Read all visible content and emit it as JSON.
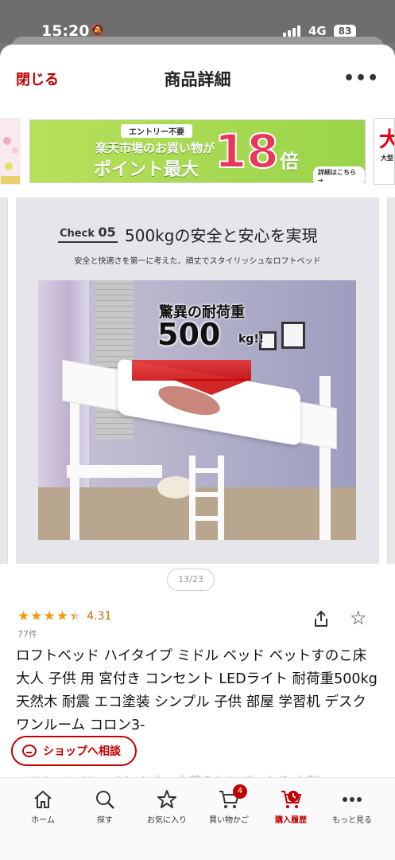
{
  "status_bar": {
    "time": "15:20",
    "network": "4G",
    "battery": "83"
  },
  "nav": {
    "close_label": "閉じる",
    "title": "商品詳細",
    "more_label": "•••"
  },
  "banner": {
    "entry": "エントリー不要",
    "line1": "楽天市場のお買い物が",
    "line2": "ポイント最大",
    "big_number": "18",
    "suffix": "倍",
    "detail": "詳細はこちら ➔",
    "next_banner_peek": "大",
    "next_banner_sub": "大型"
  },
  "gallery": {
    "check_label": "Check",
    "check_number": "05",
    "headline": "500kgの安全と安心を実現",
    "subline": "安全と快適さを第一に考えた、頑丈でスタイリッシュなロフトベッド",
    "overlay_title": "驚異の耐荷重",
    "overlay_value": "500",
    "overlay_unit": "kg!!",
    "counter": "13/23"
  },
  "product": {
    "rating_value": "4.31",
    "rating_stars": 4.31,
    "review_count": "77件",
    "title": "ロフトベッド ハイタイプ ミドル ベッド ベットすのこ床 大人 子供 用 宮付き コンセント LEDライト 耐荷重500kg 天然木 耐震 エコ塗装 シンプル 子供 部屋 学習机 デスク ワンルーム コロン3-",
    "faded_line": "ロフトベッド ハイタイプ 一人暮らしにぴったり 木製"
  },
  "shop_consult": {
    "label": "ショップへ相談"
  },
  "tabbar": {
    "items": [
      {
        "label": "ホーム",
        "icon": "home-icon"
      },
      {
        "label": "探す",
        "icon": "search-icon"
      },
      {
        "label": "お気に入り",
        "icon": "star-icon"
      },
      {
        "label": "買い物かご",
        "icon": "cart-icon",
        "badge": "4"
      },
      {
        "label": "購入履歴",
        "icon": "history-icon",
        "active": true
      },
      {
        "label": "もっと見る",
        "icon": "more-icon"
      }
    ]
  },
  "colors": {
    "brand_red": "#bf0000",
    "star_orange": "#f29b0a",
    "banner_green": "#9ad44b",
    "banner_pink": "#e8365d"
  }
}
